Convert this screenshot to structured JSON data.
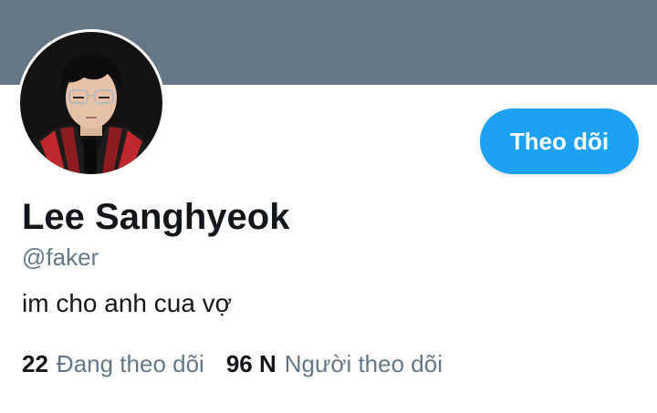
{
  "colors": {
    "banner": "#657786",
    "accent": "#1da1f2",
    "text_primary": "#14171a",
    "text_secondary": "#657786"
  },
  "profile": {
    "avatar_icon": "profile-photo",
    "display_name": "Lee Sanghyeok",
    "handle": "@faker",
    "bio": "im cho anh cua vợ",
    "follow_button_label": "Theo dõi"
  },
  "stats": {
    "following_count": "22",
    "following_label": "Đang theo dõi",
    "followers_count": "96 N",
    "followers_label": "Người theo dõi"
  }
}
